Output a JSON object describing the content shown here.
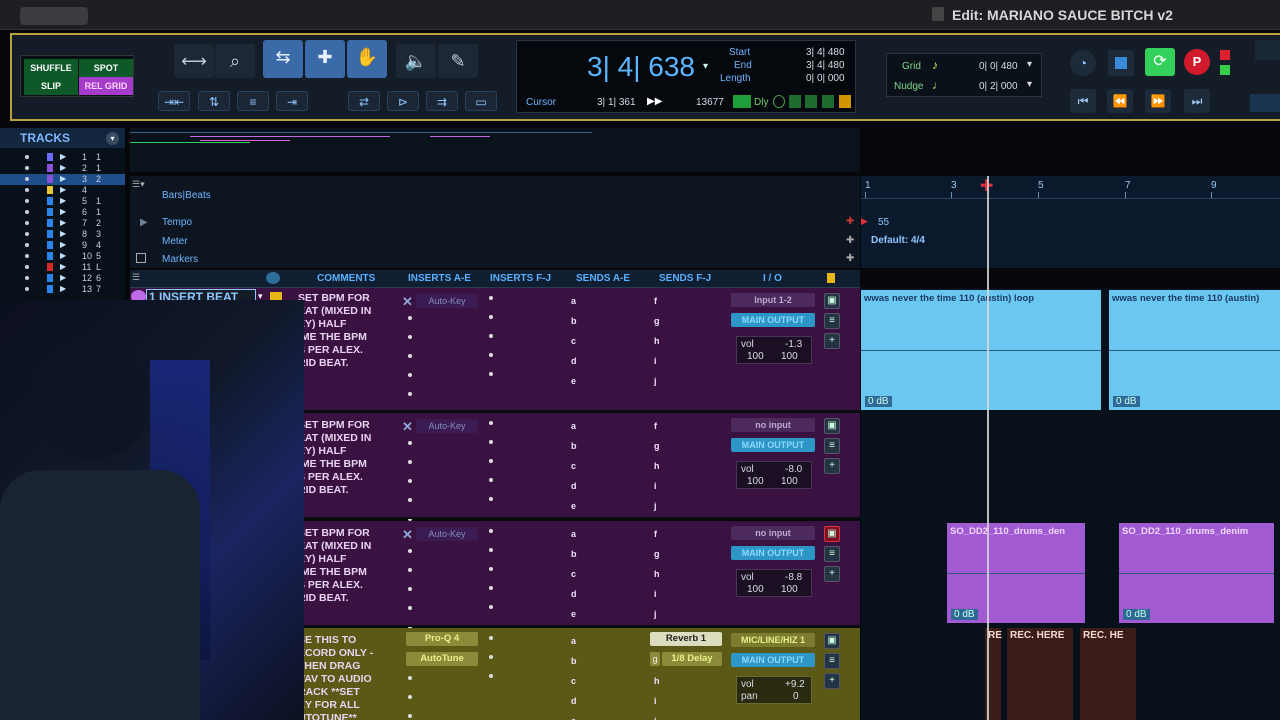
{
  "window": {
    "title": "Edit: MARIANO SAUCE BITCH v2"
  },
  "edit_modes": {
    "shuffle": "SHUFFLE",
    "spot": "SPOT",
    "slip": "SLIP",
    "grid": "REL GRID"
  },
  "counter": {
    "main": "3| 4| 638",
    "start_label": "Start",
    "end_label": "End",
    "length_label": "Length",
    "start": "3| 4| 480",
    "end": "3| 4| 480",
    "length": "0| 0| 000",
    "cursor_label": "Cursor",
    "cursor": "3| 1| 361",
    "samples": "13677",
    "dly": "Dly"
  },
  "grid": {
    "grid_label": "Grid",
    "grid_value": "0| 0| 480",
    "nudge_label": "Nudge",
    "nudge_value": "0| 2| 000"
  },
  "tracks_panel": {
    "title": "TRACKS",
    "items": [
      {
        "num": "1",
        "name": "1"
      },
      {
        "num": "2",
        "name": "1"
      },
      {
        "num": "3",
        "name": "2"
      },
      {
        "num": "4",
        "name": ""
      },
      {
        "num": "5",
        "name": "1"
      },
      {
        "num": "6",
        "name": "1"
      },
      {
        "num": "7",
        "name": "2"
      },
      {
        "num": "8",
        "name": "3"
      },
      {
        "num": "9",
        "name": "4"
      },
      {
        "num": "10",
        "name": "5"
      },
      {
        "num": "11",
        "name": "L"
      },
      {
        "num": "12",
        "name": "6"
      },
      {
        "num": "13",
        "name": "7"
      }
    ]
  },
  "rulers": {
    "bars": "Bars|Beats",
    "tempo": "Tempo",
    "meter": "Meter",
    "markers": "Markers",
    "tempo_value": "55",
    "meter_value": "Default: 4/4"
  },
  "bar_numbers": [
    "1",
    "3",
    "5",
    "7",
    "9"
  ],
  "columns": {
    "comments": "COMMENTS",
    "inserts_ae": "INSERTS A-E",
    "inserts_fj": "INSERTS F-J",
    "sends_ae": "SENDS A-E",
    "sends_fj": "SENDS F-J",
    "io": "I / O"
  },
  "selected_track": "1 INSERT BEAT",
  "send_letters_ae": [
    "a",
    "b",
    "c",
    "d",
    "e"
  ],
  "send_letters_fj": [
    "f",
    "g",
    "h",
    "i",
    "j"
  ],
  "tracks": [
    {
      "comment": "SET BPM FOR\nEAT (MIXED IN\nEY) HALF\nIME THE BPM\nS PER ALEX.\nRID BEAT.",
      "insert": "Auto-Key",
      "input": "Input 1-2",
      "output": "MAIN OUTPUT",
      "vol_label": "vol",
      "vol": "-1.3",
      "pan_l": "100",
      "pan_r": "100",
      "clips": [
        "wwas never the time 110 (austin) loop",
        "wwas never the time 110 (austin)"
      ],
      "clip_gain": "0 dB"
    },
    {
      "comment": "SET BPM FOR\nEAT (MIXED IN\nEY) HALF\nIME THE BPM\nS PER ALEX.\nRID BEAT.",
      "insert": "Auto-Key",
      "input": "no input",
      "output": "MAIN OUTPUT",
      "vol_label": "vol",
      "vol": "-8.0",
      "pan_l": "100",
      "pan_r": "100"
    },
    {
      "comment": "SET BPM FOR\nEAT (MIXED IN\nEY) HALF\nIME THE BPM\nS PER ALEX.\nRID BEAT.",
      "insert": "Auto-Key",
      "input": "no input",
      "output": "MAIN OUTPUT",
      "vol_label": "vol",
      "vol": "-8.8",
      "pan_l": "100",
      "pan_r": "100",
      "clips": [
        "SO_DD2_110_drums_den",
        "SO_DD2_110_drums_denim"
      ],
      "clip_gain": "0 dB"
    },
    {
      "comment": "SE THIS TO\nECORD ONLY -\nTHEN DRAG\nVAV TO AUDIO\nRACK **SET\nEY FOR ALL\nUTOTUNE**",
      "insert1": "Pro-Q 4",
      "insert2": "AutoTune",
      "send1": "Reverb 1",
      "send2": "1/8 Delay",
      "send2_prefix": "g",
      "input": "MIC/LINE/HIZ 1",
      "output": "MAIN OUTPUT",
      "vol_label": "vol",
      "vol": "+9.2",
      "pan_label": "pan",
      "pan": "0",
      "clips": [
        "RE",
        "REC. HERE",
        "REC. HE"
      ]
    }
  ],
  "colors": {
    "accent": "#5ab7ff",
    "purple_track": "#3a1242",
    "olive_track": "#5a5a16",
    "audio_clip": "#6ac7ef",
    "drum_clip": "#a25ad2"
  }
}
